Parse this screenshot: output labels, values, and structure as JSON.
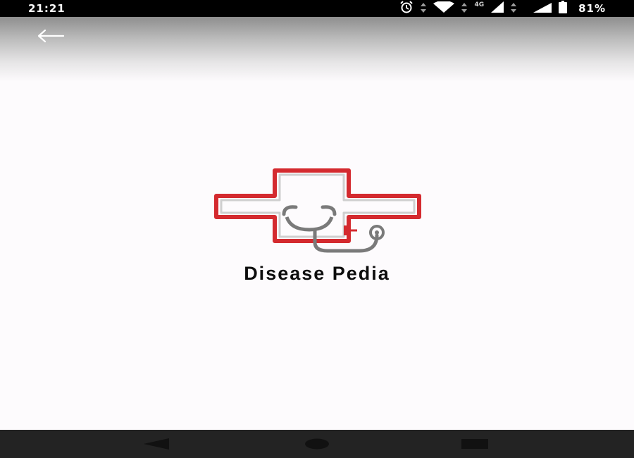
{
  "status_bar": {
    "time": "21:21",
    "network_label": "4G",
    "battery_percent": "81%",
    "icons": [
      "alarm-icon",
      "data-arrows-icon",
      "wifi-icon",
      "data-arrows-icon",
      "cell-signal-icon",
      "cell-signal-icon",
      "battery-icon"
    ]
  },
  "app_bar": {
    "back_icon": "arrow-left-icon"
  },
  "splash": {
    "app_name": "Disease Pedia",
    "logo": "medical-cross-stethoscope-logo",
    "colors": {
      "cross": "#d42a2f",
      "stethoscope": "#7a7a7a"
    }
  },
  "nav_bar": {
    "buttons": [
      "back-triangle-icon",
      "home-circle-icon",
      "recents-square-icon"
    ]
  },
  "colors": {
    "status_bar_bg": "#000000",
    "nav_bar_bg": "#232323",
    "page_bg": "#fdfbfd",
    "app_bar_top": "#8e8e8e"
  }
}
